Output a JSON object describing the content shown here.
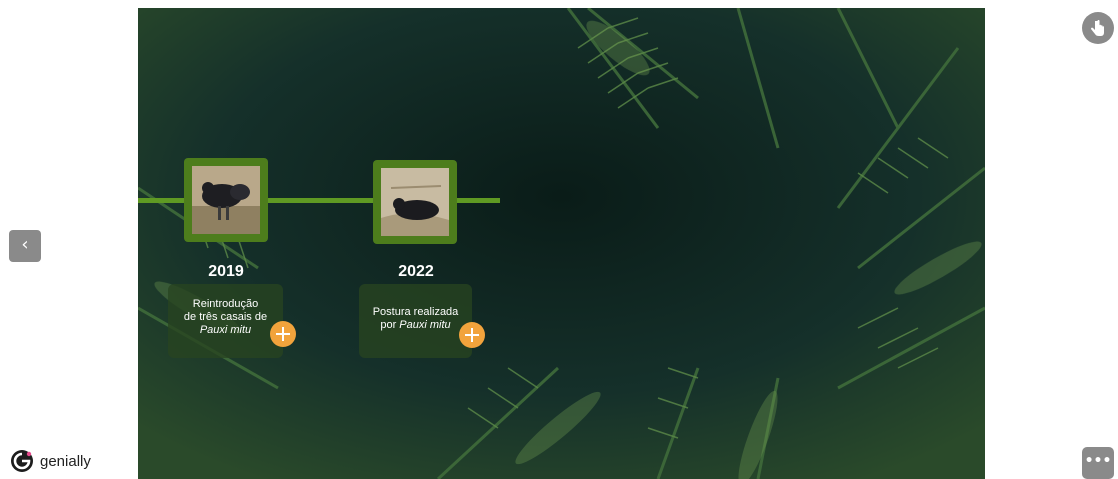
{
  "timeline": {
    "events": [
      {
        "year": "2019",
        "line1": "Reintrodução",
        "line2": "de três casais de",
        "line3_italic": "Pauxi mitu"
      },
      {
        "year": "2022",
        "line1": "Postura realizada",
        "line2_prefix": "por ",
        "line2_italic": "Pauxi mitu"
      }
    ]
  },
  "brand": {
    "name": "genially"
  },
  "icons": {
    "prev": "chevron-left-icon",
    "tap": "hand-pointer-icon",
    "more": "more-horizontal-icon",
    "plus": "plus-icon",
    "logo": "genially-logo-icon"
  },
  "colors": {
    "accent": "#f2a33c",
    "timeline": "#5f9a23",
    "frame": "#4d7d1c",
    "card": "#284420",
    "background": "#0f241f"
  }
}
